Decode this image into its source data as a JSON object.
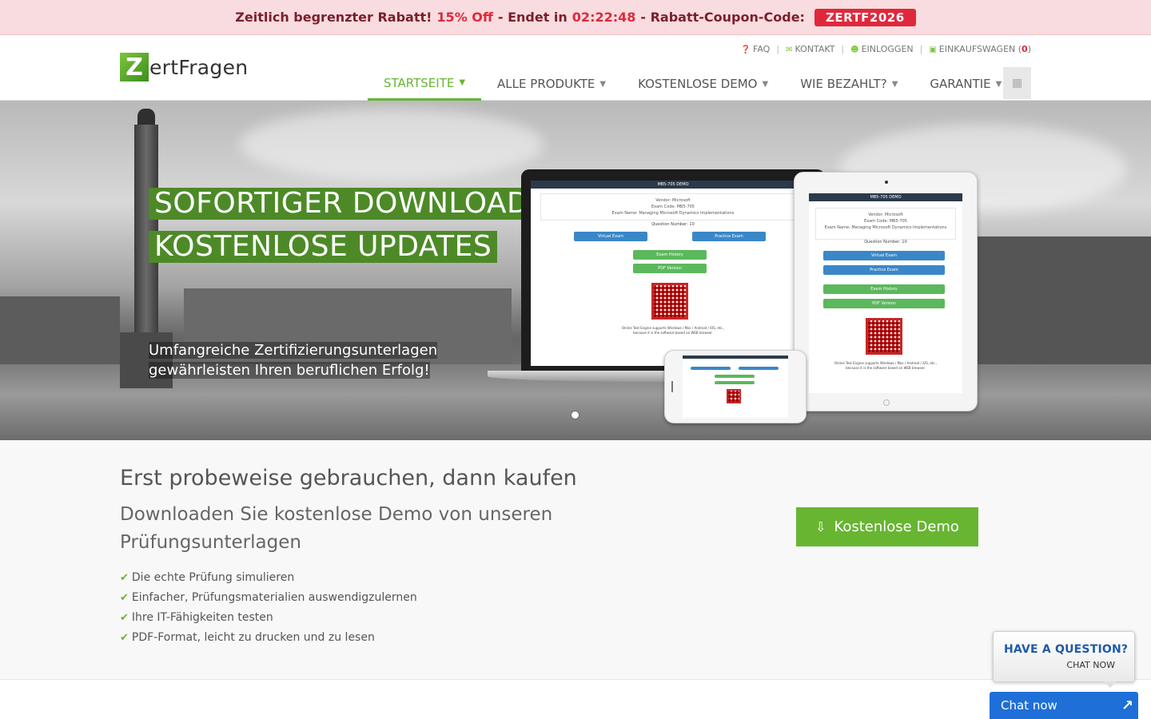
{
  "promo": {
    "text1": "Zeitlich begrenzter Rabatt!",
    "discount": "15% Off",
    "text2": "- Endet in",
    "countdown": "02:22:48",
    "text3": "- Rabatt-Coupon-Code:",
    "coupon": "ZERTF2026"
  },
  "logo": {
    "mark": "Z",
    "text": "ertFragen"
  },
  "toplinks": {
    "faq": "FAQ",
    "contact": "KONTAKT",
    "login": "EINLOGGEN",
    "cart": "EINKAUFSWAGEN",
    "cart_count": "0"
  },
  "nav": {
    "items": [
      {
        "label": "STARTSEITE"
      },
      {
        "label": "ALLE PRODUKTE"
      },
      {
        "label": "KOSTENLOSE DEMO"
      },
      {
        "label": "WIE BEZAHLT?"
      },
      {
        "label": "GARANTIE"
      }
    ]
  },
  "hero": {
    "title1": "SOFORTIGER DOWNLOAD",
    "title2": "KOSTENLOSE UPDATES",
    "subtitle": "Umfangreiche Zertifizierungsunterlagen gewährleisten Ihren beruflichen Erfolg!",
    "device": {
      "bar": "MB5-705 DEMO",
      "vendor": "Vendor: Microsoft",
      "code": "Exam Code: MB5-705",
      "name": "Exam Name: Managing Microsoft Dynamics Implementations",
      "question": "Question Number: 10",
      "virtual": "Virtual Exam",
      "practice": "Practice Exam",
      "history": "Exam History",
      "pdf": "PDF Version",
      "note1": "Online Test Engine supports Windows / Mac / Android / iOS, etc.,",
      "note2": "because it is the software based on WEB browser."
    }
  },
  "content": {
    "heading": "Erst probeweise gebrauchen, dann kaufen",
    "subheading": "Downloaden Sie kostenlose Demo von unseren Prüfungsunterlagen",
    "features": [
      "Die echte Prüfung simulieren",
      "Einfacher, Prüfungsmaterialien auswendigzulernen",
      "Ihre IT-Fähigkeiten testen",
      "PDF-Format, leicht zu drucken und zu lesen"
    ],
    "demo_button": "Kostenlose Demo"
  },
  "chat": {
    "question_title": "HAVE A QUESTION?",
    "question_sub": "CHAT NOW",
    "bar_label": "Chat now"
  },
  "colors": {
    "accent": "#67b531",
    "promo_red": "#e0283c",
    "chat_blue": "#1e6fd8"
  }
}
